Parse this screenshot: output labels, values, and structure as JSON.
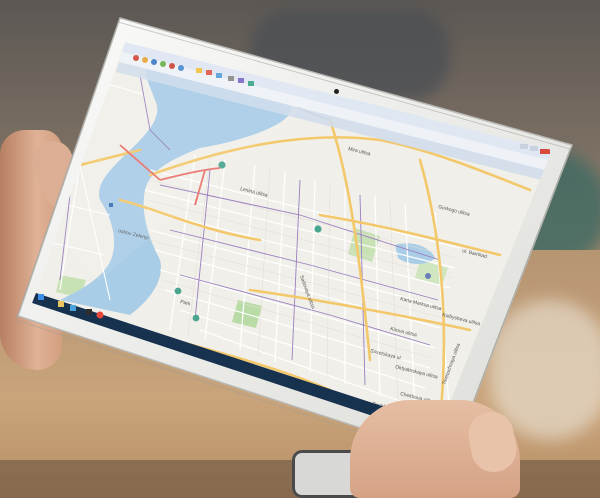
{
  "window": {
    "title_bar": "",
    "toolbar_icons": [
      "app-icon",
      "open-icon",
      "save-icon",
      "zoom-in-icon",
      "zoom-out-icon",
      "pan-icon",
      "layers-icon",
      "measure-icon",
      "route-icon",
      "print-icon",
      "settings-icon",
      "help-icon"
    ]
  },
  "map": {
    "labels": [
      {
        "text": "ul. Barrikad",
        "name": "street-ul-barrikad"
      },
      {
        "text": "Sovetskaya ul.",
        "name": "street-sovetskaya"
      },
      {
        "text": "Kuibysheva ulitsa",
        "name": "street-kuibysheva"
      },
      {
        "text": "Lenina ulitsa",
        "name": "street-lenina"
      },
      {
        "text": "Karla Marksa ulitsa",
        "name": "street-karla-marksa"
      },
      {
        "text": "Gorkogo ulitsa",
        "name": "street-gorkogo"
      },
      {
        "text": "Kirova ulitsa",
        "name": "street-kirova"
      },
      {
        "text": "Oktyabrskaya ulitsa",
        "name": "street-oktyabrskaya"
      },
      {
        "text": "Pushkina ulitsa",
        "name": "street-pushkina"
      },
      {
        "text": "Mira ulitsa",
        "name": "street-mira"
      },
      {
        "text": "Chekhova ulitsa",
        "name": "street-chekhova"
      },
      {
        "text": "Tsvetochnaya ulitsa",
        "name": "street-tsvetochnaya"
      },
      {
        "text": "Sadovaya ulitsa",
        "name": "street-sadovaya"
      },
      {
        "text": "ostrov Zelenyi",
        "name": "river-island-label"
      },
      {
        "text": "Park",
        "name": "park-label"
      }
    ],
    "colors": {
      "water": "#a9cde6",
      "land": "#f1efe9",
      "park": "#b9dba6",
      "road_major": "#f3c86b",
      "road_minor": "#ffffff",
      "road_purple": "#9b7fc1",
      "road_red": "#e9736b"
    }
  },
  "taskbar": {
    "status_text": "",
    "tray_time": ""
  }
}
